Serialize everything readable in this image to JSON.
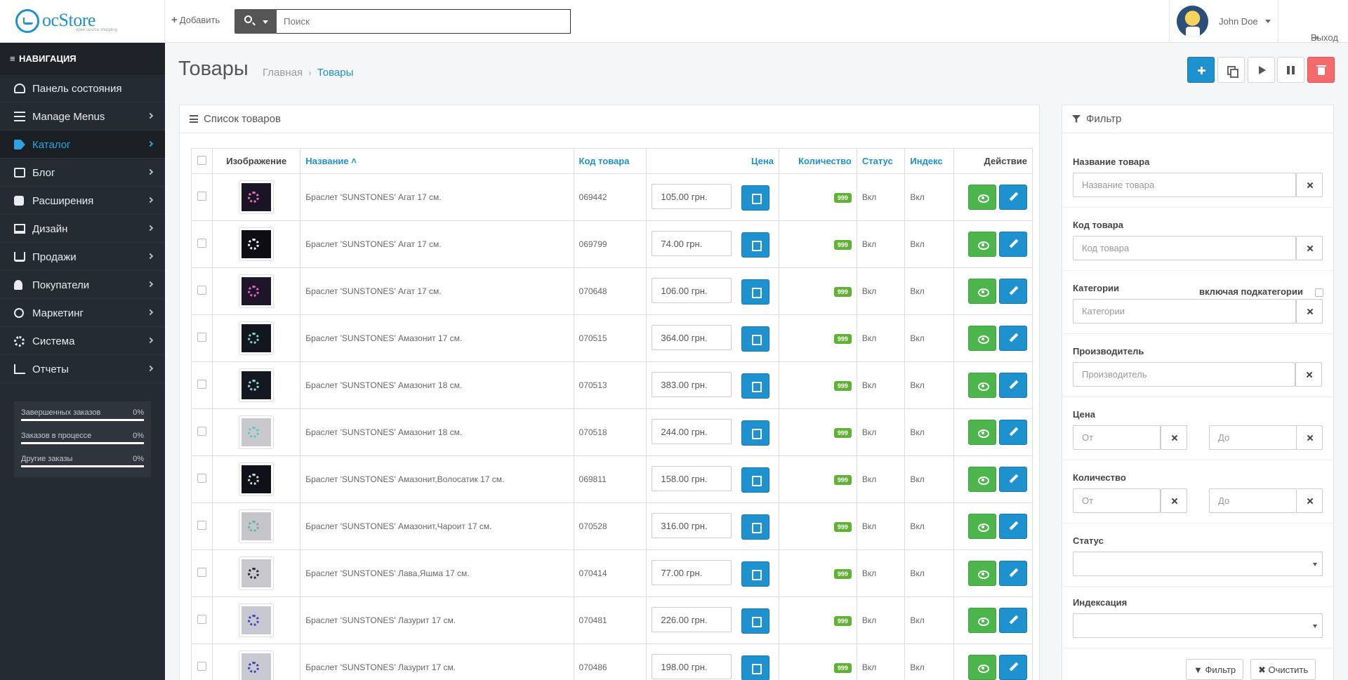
{
  "header": {
    "logo_text": "ocStore",
    "logo_tagline": "open source shopping",
    "add_label": "Добавить",
    "search_placeholder": "Поиск",
    "username": "John Doe",
    "logout_label": "Выход"
  },
  "sidebar": {
    "heading": "НАВИГАЦИЯ",
    "items": [
      {
        "label": "Панель состояния",
        "icon": "dashboard-icon",
        "chevron": false
      },
      {
        "label": "Manage Menus",
        "icon": "list-icon",
        "chevron": true
      },
      {
        "label": "Каталог",
        "icon": "tag-icon",
        "chevron": true,
        "active": true
      },
      {
        "label": "Блог",
        "icon": "book-icon",
        "chevron": true
      },
      {
        "label": "Расширения",
        "icon": "puzzle-icon",
        "chevron": true
      },
      {
        "label": "Дизайн",
        "icon": "desktop-icon",
        "chevron": true
      },
      {
        "label": "Продажи",
        "icon": "cart-icon",
        "chevron": true
      },
      {
        "label": "Покупатели",
        "icon": "user-icon",
        "chevron": true
      },
      {
        "label": "Маркетинг",
        "icon": "share-icon",
        "chevron": true
      },
      {
        "label": "Система",
        "icon": "gear-icon",
        "chevron": true
      },
      {
        "label": "Отчеты",
        "icon": "bar-chart-icon",
        "chevron": true
      }
    ],
    "stats": [
      {
        "label": "Завершенных заказов",
        "value": "0%",
        "progress": 0
      },
      {
        "label": "Заказов в процессе",
        "value": "0%",
        "progress": 0
      },
      {
        "label": "Другие заказы",
        "value": "0%",
        "progress": 0
      }
    ]
  },
  "page": {
    "title": "Товары",
    "breadcrumb": [
      "Главная",
      "Товары"
    ],
    "breadcrumb_sep": "›"
  },
  "list": {
    "title": "Список товаров",
    "columns": {
      "image": "Изображение",
      "name": "Название",
      "model": "Код товара",
      "price": "Цена",
      "quantity": "Количество",
      "status": "Статус",
      "index": "Индекс",
      "action": "Действие"
    },
    "rows": [
      {
        "name": "Браслет 'SUNSTONES' Агат 17 см.",
        "model": "069442",
        "price": "105.00 грн.",
        "qty": "999",
        "status": "Вкл",
        "index": "Вкл",
        "bg": "#1a1424",
        "ring": "#e46fc9"
      },
      {
        "name": "Браслет 'SUNSTONES' Агат 17 см.",
        "model": "069799",
        "price": "74.00 грн.",
        "qty": "999",
        "status": "Вкл",
        "index": "Вкл",
        "bg": "#0e0e12",
        "ring": "#f2f2f2"
      },
      {
        "name": "Браслет 'SUNSTONES' Агат 17 см.",
        "model": "070648",
        "price": "106.00 грн.",
        "qty": "999",
        "status": "Вкл",
        "index": "Вкл",
        "bg": "#1e1628",
        "ring": "#f05cc4"
      },
      {
        "name": "Браслет 'SUNSTONES' Амазонит 17 см.",
        "model": "070515",
        "price": "364.00 грн.",
        "qty": "999",
        "status": "Вкл",
        "index": "Вкл",
        "bg": "#12161e",
        "ring": "#7fd4d0"
      },
      {
        "name": "Браслет 'SUNSTONES' Амазонит 18 см.",
        "model": "070513",
        "price": "383.00 грн.",
        "qty": "999",
        "status": "Вкл",
        "index": "Вкл",
        "bg": "#141820",
        "ring": "#8ed8d4"
      },
      {
        "name": "Браслет 'SUNSTONES' Амазонит 18 см.",
        "model": "070518",
        "price": "244.00 грн.",
        "qty": "999",
        "status": "Вкл",
        "index": "Вкл",
        "bg": "#c9c9cd",
        "ring": "#5cc6c0"
      },
      {
        "name": "Браслет 'SUNSTONES' Амазонит,Волосатик 17 см.",
        "model": "069811",
        "price": "158.00 грн.",
        "qty": "999",
        "status": "Вкл",
        "index": "Вкл",
        "bg": "#0f1018",
        "ring": "#cfd6d8"
      },
      {
        "name": "Браслет 'SUNSTONES' Амазонит,Чароит 17 см.",
        "model": "070528",
        "price": "316.00 грн.",
        "qty": "999",
        "status": "Вкл",
        "index": "Вкл",
        "bg": "#c6c5ca",
        "ring": "#5fb89a"
      },
      {
        "name": "Браслет 'SUNSTONES' Лава,Яшма 17 см.",
        "model": "070414",
        "price": "77.00 грн.",
        "qty": "999",
        "status": "Вкл",
        "index": "Вкл",
        "bg": "#c8c8cc",
        "ring": "#2a2a2e"
      },
      {
        "name": "Браслет 'SUNSTONES' Лазурит 17 см.",
        "model": "070481",
        "price": "226.00 грн.",
        "qty": "999",
        "status": "Вкл",
        "index": "Вкл",
        "bg": "#c7c7cf",
        "ring": "#3a48c8"
      },
      {
        "name": "Браслет 'SUNSTONES' Лазурит 17 см.",
        "model": "070486",
        "price": "198.00 грн.",
        "qty": "999",
        "status": "Вкл",
        "index": "Вкл",
        "bg": "#c9c9d1",
        "ring": "#3644bd"
      }
    ]
  },
  "filter": {
    "title": "Фильтр",
    "name_label": "Название товара",
    "name_placeholder": "Название товара",
    "model_label": "Код товара",
    "model_placeholder": "Код товара",
    "category_label": "Категории",
    "subcategory_label": "включая подкатегории",
    "category_placeholder": "Категории",
    "manufacturer_label": "Производитель",
    "manufacturer_placeholder": "Производитель",
    "price_label": "Цена",
    "from_placeholder": "От",
    "to_placeholder": "До",
    "quantity_label": "Количество",
    "status_label": "Статус",
    "status_value": "",
    "indexing_label": "Индексация",
    "indexing_value": "",
    "filter_button": "Фильтр",
    "clear_button": "Очистить"
  },
  "colors": {
    "accent": "#1e91cf",
    "sidebar_bg": "#242b33",
    "success": "#4cb64c",
    "danger": "#f56b6b"
  }
}
